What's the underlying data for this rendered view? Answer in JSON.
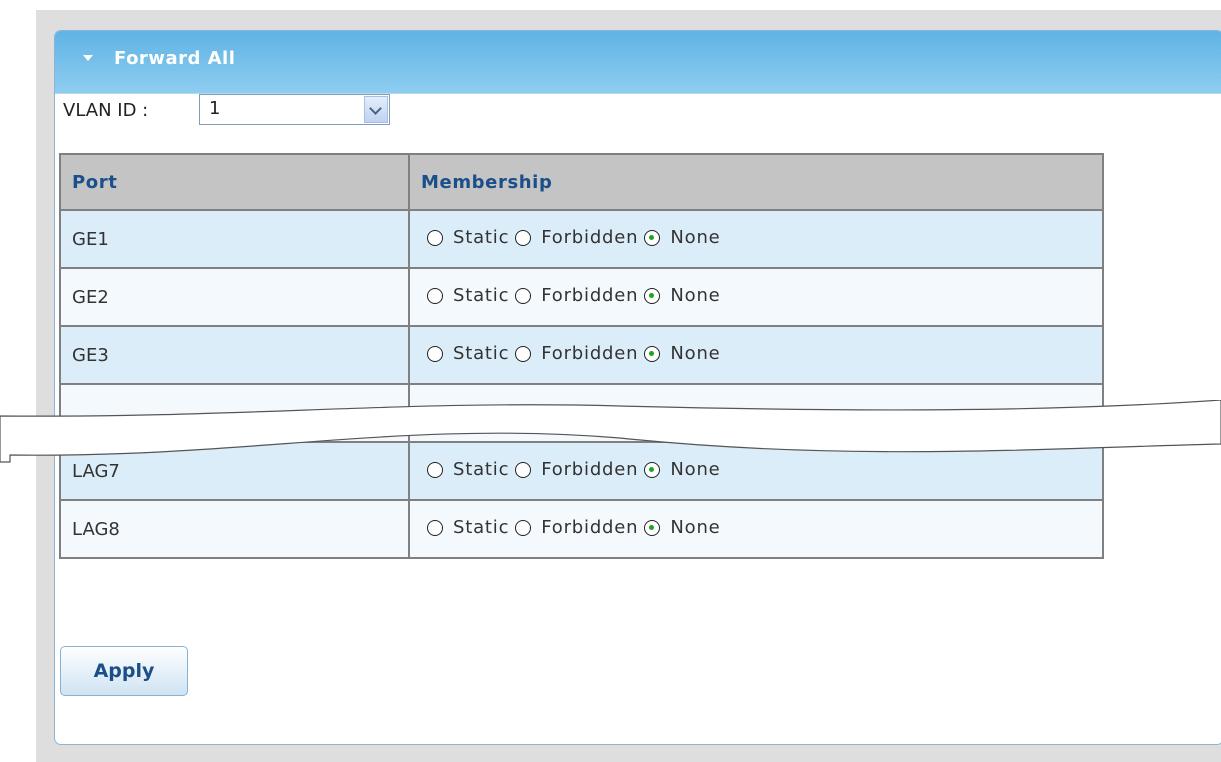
{
  "panel": {
    "title": "Forward All"
  },
  "vlan": {
    "label": "VLAN ID :",
    "value": "1"
  },
  "table": {
    "headers": {
      "port": "Port",
      "membership": "Membership"
    },
    "options": {
      "static": "Static",
      "forbidden": "Forbidden",
      "none": "None"
    },
    "rows_top": [
      {
        "port": "GE1",
        "selected": "none"
      },
      {
        "port": "GE2",
        "selected": "none"
      },
      {
        "port": "GE3",
        "selected": "none"
      }
    ],
    "rows_bottom": [
      {
        "port": "LAG7",
        "selected": "none"
      },
      {
        "port": "LAG8",
        "selected": "none"
      }
    ]
  },
  "actions": {
    "apply_label": "Apply"
  },
  "colors": {
    "header_gradient_top": "#5fb3e5",
    "header_gradient_bottom": "#8ecdf0",
    "table_header_bg": "#c4c4c4",
    "row_odd": "#dcedfa",
    "row_even": "#f4f9fe",
    "radio_checked": "#1fa51f",
    "header_text": "#1a4f8a"
  },
  "icons": {
    "collapse": "triangle-down-icon",
    "dropdown": "chevron-down-icon"
  }
}
